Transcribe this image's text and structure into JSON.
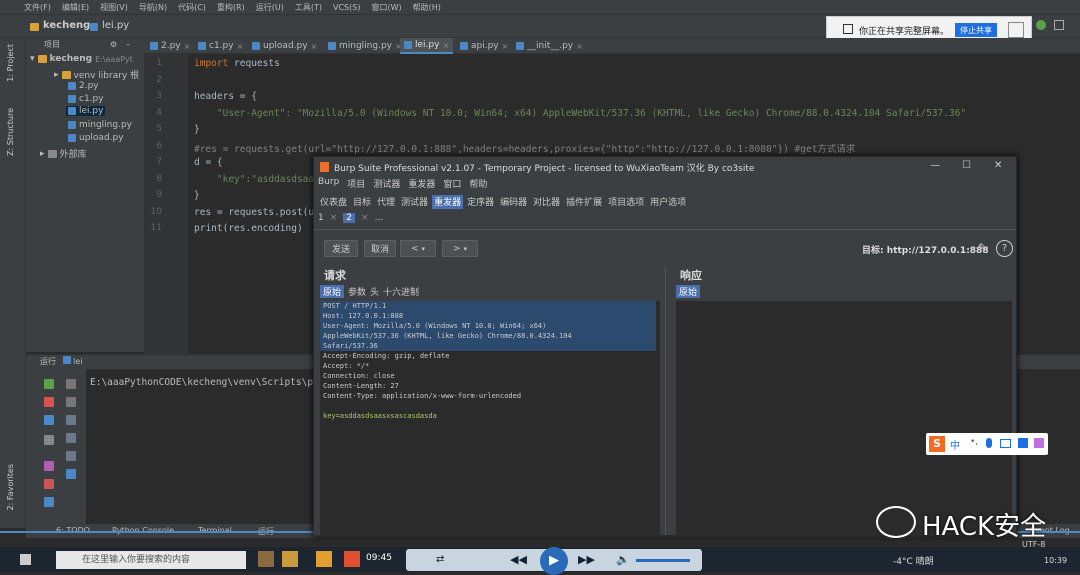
{
  "menubar": [
    "文件(F)",
    "编辑(E)",
    "视图(V)",
    "导航(N)",
    "代码(C)",
    "重构(R)",
    "运行(U)",
    "工具(T)",
    "VCS(S)",
    "窗口(W)",
    "帮助(H)"
  ],
  "breadcrumb": {
    "project": "kecheng",
    "file": "lei.py"
  },
  "share_bar": {
    "text": "你正在共享完整屏幕。",
    "button": "停止共享"
  },
  "project_panel": {
    "title": "项目",
    "root": "kecheng",
    "root_path": "E:\\aaaPyt",
    "venv": "venv library 根",
    "files": [
      "2.py",
      "c1.py",
      "lei.py",
      "mingling.py",
      "upload.py"
    ],
    "external": "外部库",
    "side_label_project": "1: Project",
    "side_label_structure": "Z: Structure",
    "side_label_favorites": "2: Favorites"
  },
  "editor_tabs": [
    "2.py",
    "c1.py",
    "upload.py",
    "mingling.py",
    "lei.py",
    "api.py",
    "__init__.py"
  ],
  "active_tab": "lei.py",
  "line_numbers": [
    "1",
    "2",
    "3",
    "4",
    "5",
    "6",
    "7",
    "8",
    "9",
    "10",
    "11"
  ],
  "code_lines": {
    "l1_kw": "import",
    "l1_rest": " requests",
    "l3": "headers = {",
    "l4_key": "    \"User-Agent\"",
    "l4_rest": ": \"Mozilla/5.0 (Windows NT 10.0; Win64; x64) AppleWebKit/537.36 (KHTML, like Gecko) Chrome/88.0.4324.104 Safari/537.36\"",
    "l5": "}",
    "l6": "#res = requests.get(url=\"http://127.0.0.1:888\",headers=headers,proxies={\"http\":\"http://127.0.0.1:8080\"}) #get方式请求",
    "l7": "d = {",
    "l8_key": "    \"key\"",
    "l8_rest": ":\"asddasdsaas",
    "l9": "}",
    "l10": "res = requests.post(u",
    "l11": "print(res.encoding)"
  },
  "run_panel": {
    "title": "运行",
    "config": "lei",
    "output": "E:\\aaaPythonCODE\\kecheng\\venv\\Scripts\\py"
  },
  "bottom_tabs": [
    "6: TODO",
    "Python Console",
    "Terminal",
    "运行"
  ],
  "burp": {
    "title": "Burp Suite Professional v2.1.07 - Temporary Project - licensed to WuXiaoTeam 汉化 By co3site",
    "menu": [
      "Burp",
      "项目",
      "测试器",
      "重发器",
      "窗口",
      "帮助"
    ],
    "tabs": [
      "仪表盘",
      "目标",
      "代理",
      "测试器",
      "重发器",
      "定序器",
      "编码器",
      "对比器",
      "插件扩展",
      "项目选项",
      "用户选项"
    ],
    "selected_tab": "重发器",
    "subtabs": [
      "1",
      "×",
      "2",
      "×",
      "..."
    ],
    "send": "发送",
    "cancel": "取消",
    "target_label": "目标: http://127.0.0.1:888",
    "request_title": "请求",
    "request_tabs": [
      "原始",
      "参数",
      "头",
      "十六进制"
    ],
    "response_title": "响应",
    "response_tabs": [
      "原始"
    ],
    "request_lines": [
      "POST / HTTP/1.1",
      "Host: 127.0.0.1:888",
      "User-Agent: Mozilla/5.0 (Windows NT 10.0; Win64; x64)",
      "AppleWebKit/537.36 (KHTML, like Gecko) Chrome/88.0.4324.104",
      "Safari/537.36",
      "Accept-Encoding: gzip, deflate",
      "Accept: */*",
      "Connection: close",
      "Content-Length: 27",
      "Content-Type: application/x-www-form-urlencoded",
      "",
      "key=asddasdsaasxsascasdasda"
    ]
  },
  "taskbar": {
    "search": "在这里输入你要搜索的内容",
    "media_time": "09:45",
    "weather": "-4°C 晴朗",
    "clock": "10:39"
  },
  "status": {
    "encoding": "UTF-8",
    "event_log": "Event Log"
  },
  "watermark": "HACK安全",
  "sogou": "中"
}
